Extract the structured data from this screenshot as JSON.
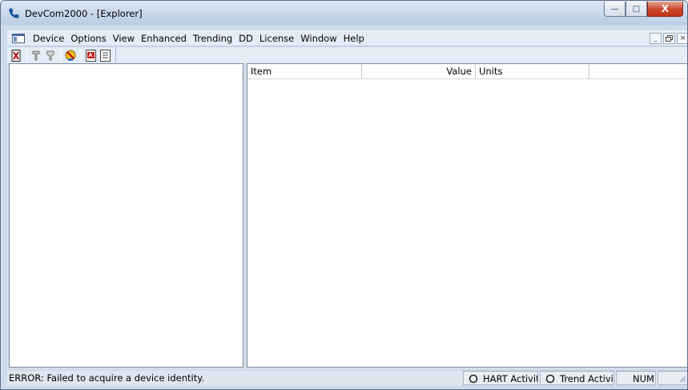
{
  "window": {
    "title": "DevCom2000 - [Explorer]",
    "caption_min": "—",
    "caption_max": "□",
    "caption_close": "X"
  },
  "menubar": {
    "items": [
      "Device",
      "Options",
      "View",
      "Enhanced",
      "Trending",
      "DD",
      "License",
      "Window",
      "Help"
    ],
    "mdi_min": "_",
    "mdi_restore": "š",
    "mdi_close": "×"
  },
  "toolbar": {
    "icons": [
      "connect-icon",
      "hart-probe-icon",
      "hart-probe-alt-icon",
      "device-settings-icon",
      "pdf-report-icon",
      "document-icon"
    ]
  },
  "list": {
    "columns": [
      "Item",
      "Value",
      "Units",
      ""
    ]
  },
  "statusbar": {
    "message": "ERROR: Failed to acquire a device identity.",
    "hart_activity": "HART Activit",
    "trend_activity": "Trend Activit",
    "num": "NUM"
  },
  "colors": {
    "frame": "#cfdbea",
    "close_button": "#c9452b",
    "pane_background": "#ffffff"
  }
}
